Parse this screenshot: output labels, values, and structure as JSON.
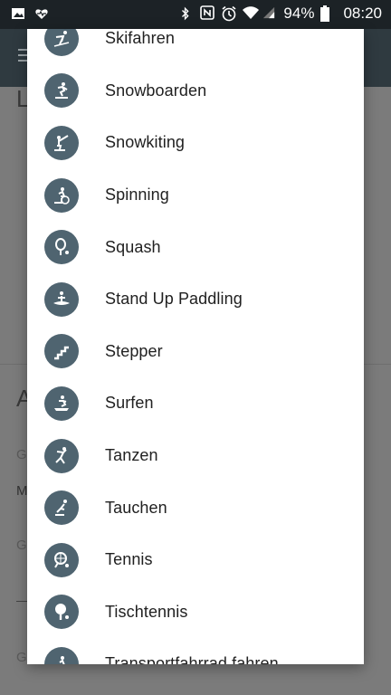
{
  "status_bar": {
    "battery": "94%",
    "time": "08:20",
    "icons_left": [
      "image-icon",
      "heart-pulse-icon"
    ],
    "icons_right": [
      "bluetooth-icon",
      "nfc-icon",
      "alarm-icon",
      "wifi-icon",
      "signal-icon",
      "battery-icon"
    ]
  },
  "background": {
    "letter_top": "L",
    "letter_mid": "A",
    "small_1": "G",
    "small_2": "M",
    "small_3": "G",
    "small_4": "G"
  },
  "sports": [
    {
      "label": "Skifahren",
      "icon": "skiing-icon"
    },
    {
      "label": "Snowboarden",
      "icon": "snowboard-icon"
    },
    {
      "label": "Snowkiting",
      "icon": "snowkite-icon"
    },
    {
      "label": "Spinning",
      "icon": "spinning-icon"
    },
    {
      "label": "Squash",
      "icon": "squash-icon"
    },
    {
      "label": "Stand Up Paddling",
      "icon": "paddle-icon"
    },
    {
      "label": "Stepper",
      "icon": "stairs-icon"
    },
    {
      "label": "Surfen",
      "icon": "surf-icon"
    },
    {
      "label": "Tanzen",
      "icon": "dance-icon"
    },
    {
      "label": "Tauchen",
      "icon": "diving-icon"
    },
    {
      "label": "Tennis",
      "icon": "tennis-icon"
    },
    {
      "label": "Tischtennis",
      "icon": "table-tennis-icon"
    },
    {
      "label": "Transportfahrrad fahren",
      "icon": "cargo-bike-icon"
    }
  ],
  "colors": {
    "icon_circle": "#4f6470",
    "status_bar": "#1c2226",
    "app_bar": "#2f3a40"
  }
}
